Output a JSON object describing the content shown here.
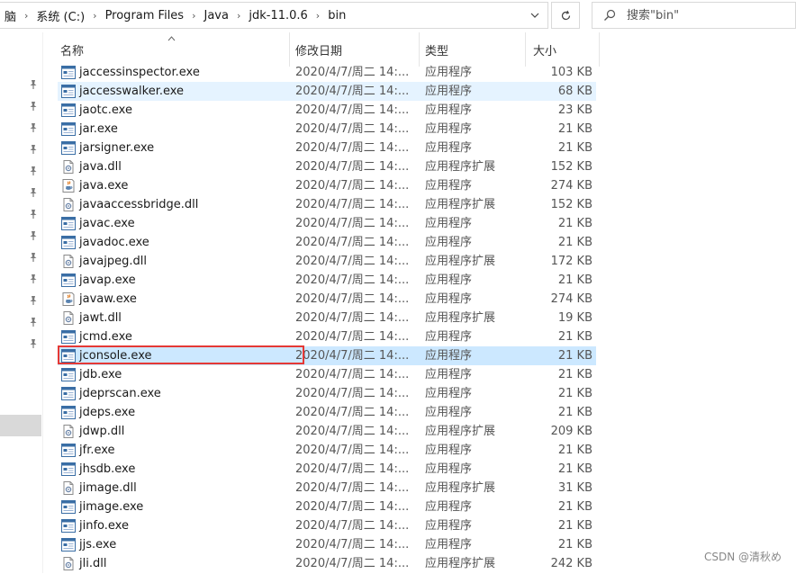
{
  "address": {
    "segments": [
      "脑",
      "系统 (C:)",
      "Program Files",
      "Java",
      "jdk-11.0.6",
      "bin"
    ]
  },
  "search": {
    "placeholder": "搜索\"bin\""
  },
  "columns": {
    "name": "名称",
    "date": "修改日期",
    "type": "类型",
    "size": "大小"
  },
  "files": [
    {
      "name": "jaccessinspector.exe",
      "date": "2020/4/7/周二 14:...",
      "type": "应用程序",
      "size": "103 KB",
      "icon": "exe-window-icon",
      "state": ""
    },
    {
      "name": "jaccesswalker.exe",
      "date": "2020/4/7/周二 14:...",
      "type": "应用程序",
      "size": "68 KB",
      "icon": "exe-window-icon",
      "state": "hover"
    },
    {
      "name": "jaotc.exe",
      "date": "2020/4/7/周二 14:...",
      "type": "应用程序",
      "size": "23 KB",
      "icon": "exe-window-icon",
      "state": ""
    },
    {
      "name": "jar.exe",
      "date": "2020/4/7/周二 14:...",
      "type": "应用程序",
      "size": "21 KB",
      "icon": "exe-window-icon",
      "state": ""
    },
    {
      "name": "jarsigner.exe",
      "date": "2020/4/7/周二 14:...",
      "type": "应用程序",
      "size": "21 KB",
      "icon": "exe-window-icon",
      "state": ""
    },
    {
      "name": "java.dll",
      "date": "2020/4/7/周二 14:...",
      "type": "应用程序扩展",
      "size": "152 KB",
      "icon": "dll-gear-icon",
      "state": ""
    },
    {
      "name": "java.exe",
      "date": "2020/4/7/周二 14:...",
      "type": "应用程序",
      "size": "274 KB",
      "icon": "java-coffee-icon",
      "state": ""
    },
    {
      "name": "javaaccessbridge.dll",
      "date": "2020/4/7/周二 14:...",
      "type": "应用程序扩展",
      "size": "152 KB",
      "icon": "dll-gear-icon",
      "state": ""
    },
    {
      "name": "javac.exe",
      "date": "2020/4/7/周二 14:...",
      "type": "应用程序",
      "size": "21 KB",
      "icon": "exe-window-icon",
      "state": ""
    },
    {
      "name": "javadoc.exe",
      "date": "2020/4/7/周二 14:...",
      "type": "应用程序",
      "size": "21 KB",
      "icon": "exe-window-icon",
      "state": ""
    },
    {
      "name": "javajpeg.dll",
      "date": "2020/4/7/周二 14:...",
      "type": "应用程序扩展",
      "size": "172 KB",
      "icon": "dll-gear-icon",
      "state": ""
    },
    {
      "name": "javap.exe",
      "date": "2020/4/7/周二 14:...",
      "type": "应用程序",
      "size": "21 KB",
      "icon": "exe-window-icon",
      "state": ""
    },
    {
      "name": "javaw.exe",
      "date": "2020/4/7/周二 14:...",
      "type": "应用程序",
      "size": "274 KB",
      "icon": "java-coffee-icon",
      "state": ""
    },
    {
      "name": "jawt.dll",
      "date": "2020/4/7/周二 14:...",
      "type": "应用程序扩展",
      "size": "19 KB",
      "icon": "dll-gear-icon",
      "state": ""
    },
    {
      "name": "jcmd.exe",
      "date": "2020/4/7/周二 14:...",
      "type": "应用程序",
      "size": "21 KB",
      "icon": "exe-window-icon",
      "state": ""
    },
    {
      "name": "jconsole.exe",
      "date": "2020/4/7/周二 14:...",
      "type": "应用程序",
      "size": "21 KB",
      "icon": "exe-window-icon",
      "state": "selected"
    },
    {
      "name": "jdb.exe",
      "date": "2020/4/7/周二 14:...",
      "type": "应用程序",
      "size": "21 KB",
      "icon": "exe-window-icon",
      "state": ""
    },
    {
      "name": "jdeprscan.exe",
      "date": "2020/4/7/周二 14:...",
      "type": "应用程序",
      "size": "21 KB",
      "icon": "exe-window-icon",
      "state": ""
    },
    {
      "name": "jdeps.exe",
      "date": "2020/4/7/周二 14:...",
      "type": "应用程序",
      "size": "21 KB",
      "icon": "exe-window-icon",
      "state": ""
    },
    {
      "name": "jdwp.dll",
      "date": "2020/4/7/周二 14:...",
      "type": "应用程序扩展",
      "size": "209 KB",
      "icon": "dll-gear-icon",
      "state": ""
    },
    {
      "name": "jfr.exe",
      "date": "2020/4/7/周二 14:...",
      "type": "应用程序",
      "size": "21 KB",
      "icon": "exe-window-icon",
      "state": ""
    },
    {
      "name": "jhsdb.exe",
      "date": "2020/4/7/周二 14:...",
      "type": "应用程序",
      "size": "21 KB",
      "icon": "exe-window-icon",
      "state": ""
    },
    {
      "name": "jimage.dll",
      "date": "2020/4/7/周二 14:...",
      "type": "应用程序扩展",
      "size": "31 KB",
      "icon": "dll-gear-icon",
      "state": ""
    },
    {
      "name": "jimage.exe",
      "date": "2020/4/7/周二 14:...",
      "type": "应用程序",
      "size": "21 KB",
      "icon": "exe-window-icon",
      "state": ""
    },
    {
      "name": "jinfo.exe",
      "date": "2020/4/7/周二 14:...",
      "type": "应用程序",
      "size": "21 KB",
      "icon": "exe-window-icon",
      "state": ""
    },
    {
      "name": "jjs.exe",
      "date": "2020/4/7/周二 14:...",
      "type": "应用程序",
      "size": "21 KB",
      "icon": "exe-window-icon",
      "state": ""
    },
    {
      "name": "jli.dll",
      "date": "2020/4/7/周二 14:...",
      "type": "应用程序扩展",
      "size": "242 KB",
      "icon": "dll-gear-icon",
      "state": ""
    }
  ],
  "watermark": "CSDN @清秋め",
  "colors": {
    "selected": "#cce8ff",
    "hover": "#e5f3ff",
    "highlight_box": "#e53935"
  }
}
